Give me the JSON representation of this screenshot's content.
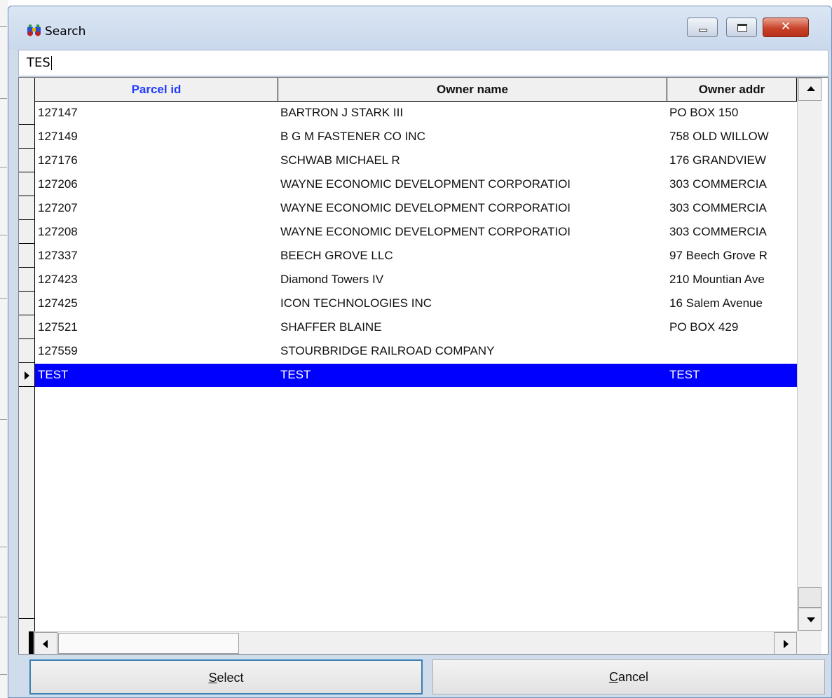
{
  "window": {
    "title": "Search"
  },
  "search": {
    "value": "TES"
  },
  "grid": {
    "columns": [
      "Parcel id",
      "Owner name",
      "Owner addr"
    ],
    "rows": [
      [
        "127147",
        "BARTRON J STARK III",
        "PO BOX 150"
      ],
      [
        "127149",
        "B G M FASTENER CO INC",
        "758 OLD WILLOW"
      ],
      [
        "127176",
        "SCHWAB MICHAEL R",
        "176 GRANDVIEW"
      ],
      [
        "127206",
        "WAYNE ECONOMIC DEVELOPMENT CORPORATIOI",
        "303 COMMERCIA"
      ],
      [
        "127207",
        "WAYNE ECONOMIC DEVELOPMENT CORPORATIOI",
        "303 COMMERCIA"
      ],
      [
        "127208",
        "WAYNE ECONOMIC DEVELOPMENT CORPORATIOI",
        "303 COMMERCIA"
      ],
      [
        "127337",
        "BEECH GROVE LLC",
        "97 Beech Grove R"
      ],
      [
        "127423",
        "Diamond Towers IV",
        "210 Mountian Ave"
      ],
      [
        "127425",
        "ICON TECHNOLOGIES INC",
        "16 Salem Avenue"
      ],
      [
        "127521",
        "SHAFFER BLAINE",
        "PO BOX 429"
      ],
      [
        "127559",
        "STOURBRIDGE RAILROAD COMPANY",
        ""
      ],
      [
        "TEST",
        "TEST",
        "TEST"
      ]
    ],
    "selected_row": 11,
    "selection_color": "#0000ff",
    "header_link_color": "#1f3bff"
  },
  "buttons": {
    "select_accel": "S",
    "select_rest": "elect",
    "cancel_accel": "C",
    "cancel_rest": "ancel"
  }
}
